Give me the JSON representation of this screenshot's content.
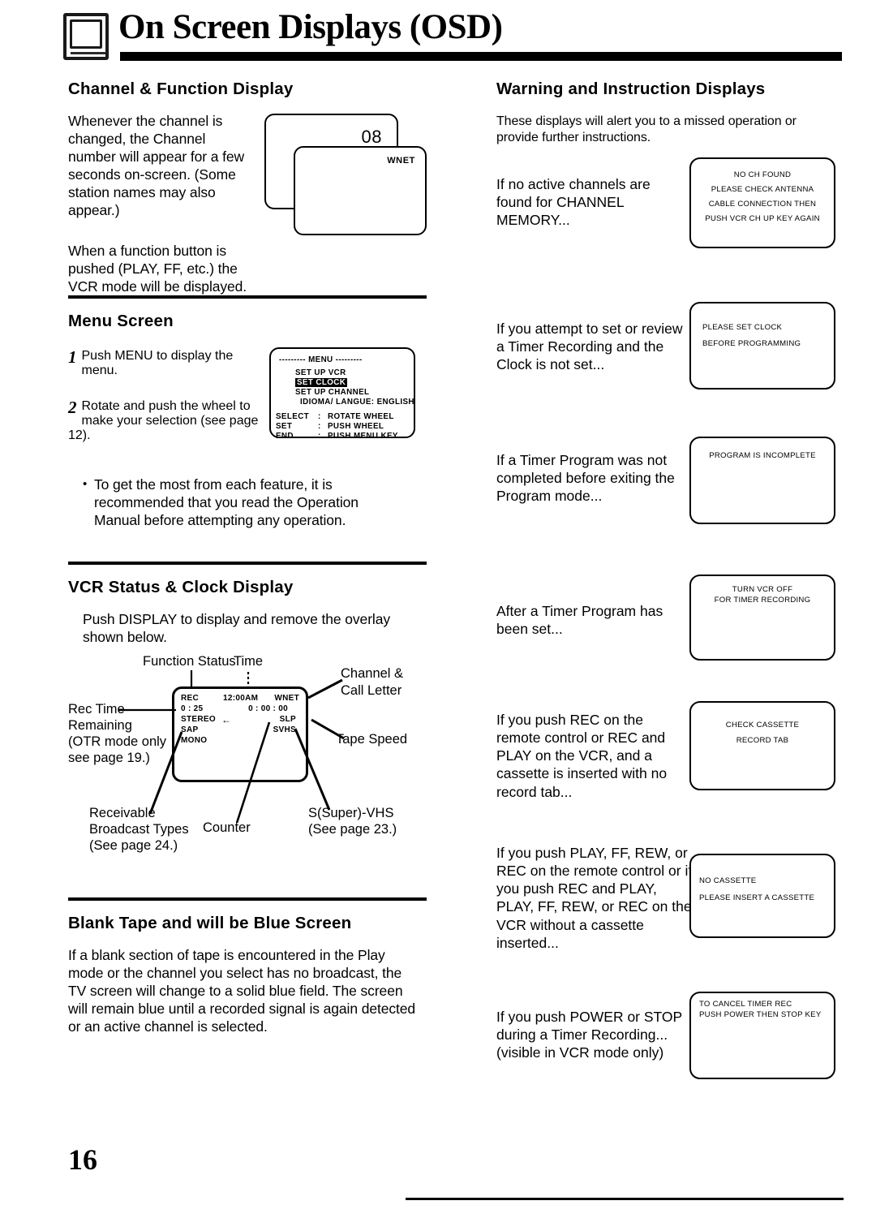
{
  "header": {
    "title": "On Screen Displays (OSD)",
    "icon": "tv-screen-icon"
  },
  "page_number": "16",
  "left_column": {
    "channel_function": {
      "heading": "Channel & Function Display",
      "paragraph1": "Whenever the channel is changed, the Channel number will appear for a few seconds on-screen. (Some station names may also appear.)",
      "paragraph2": "When a function button is pushed (PLAY, FF, etc.) the VCR mode will be displayed.",
      "screen_back_value": "08",
      "screen_front_value": "WNET"
    },
    "menu_screen": {
      "heading": "Menu Screen",
      "step1_number": "1",
      "step1_text": "Push MENU to display the menu.",
      "step2_number": "2",
      "step2_text": "Rotate and push the wheel to make your selection (see page 12).",
      "bullet": "To get the most from each feature, it is recommended that you read the Operation Manual before attempting any operation.",
      "osd": {
        "title": "--------- MENU ---------",
        "items": [
          "SET UP VCR",
          "SET CLOCK",
          "SET UP CHANNEL",
          "IDIOMA/ LANGUE: ENGLISH"
        ],
        "highlighted_item": "SET CLOCK",
        "legend": [
          {
            "key": "SELECT",
            "sep": ":",
            "value": "ROTATE  WHEEL"
          },
          {
            "key": "SET",
            "sep": ":",
            "value": "PUSH  WHEEL"
          },
          {
            "key": "END",
            "sep": ":",
            "value": "PUSH  MENU  KEY"
          }
        ]
      }
    },
    "vcr_status": {
      "heading": "VCR Status & Clock Display",
      "paragraph": "Push DISPLAY to display and remove the overlay shown below.",
      "osd": {
        "rec": "REC",
        "rec_time": "0 : 25",
        "stereo": "STEREO",
        "stereo_arrow": "←",
        "sap": "SAP",
        "mono": "MONO",
        "time": "12:00AM",
        "channel": "WNET",
        "counter": "0 : 00 : 00",
        "speed": "SLP",
        "svhs": "SVHS"
      },
      "callouts": {
        "function_status": "Function Status",
        "time": "Time",
        "channel_call_letter_1": "Channel &",
        "channel_call_letter_2": "Call Letter",
        "rec_time_1": "Rec Time",
        "rec_time_2": "Remaining",
        "rec_time_3": "(OTR mode only",
        "rec_time_4": "see page 19.)",
        "tape_speed": "Tape Speed",
        "receivable_1": "Receivable",
        "receivable_2": "Broadcast Types",
        "receivable_3": "(See page 24.)",
        "counter": "Counter",
        "svhs_1": "S(Super)-VHS",
        "svhs_2": "(See page 23.)"
      }
    },
    "blank_tape": {
      "heading": "Blank Tape and will be Blue Screen",
      "paragraph": "If a blank section of tape is encountered in the Play mode or the channel you select has no broadcast, the TV screen will change to a solid blue field. The screen will remain blue until a recorded signal is again detected or an active channel is selected."
    }
  },
  "right_column": {
    "heading": "Warning and Instruction Displays",
    "intro": "These displays will alert you to a missed operation or provide further instructions.",
    "warnings": [
      {
        "text": "If no active channels are found for CHANNEL MEMORY...",
        "align": "center",
        "lines": [
          "NO CH FOUND",
          "PLEASE CHECK ANTENNA",
          "CABLE CONNECTION THEN",
          "PUSH VCR CH UP KEY AGAIN"
        ]
      },
      {
        "text": "If you attempt to set or review a Timer Recording and the Clock is not set...",
        "align": "left",
        "lines": [
          "PLEASE SET CLOCK",
          "BEFORE PROGRAMMING"
        ]
      },
      {
        "text": "If a Timer Program was not completed before exiting the Program mode...",
        "align": "center",
        "lines": [
          "PROGRAM IS INCOMPLETE"
        ]
      },
      {
        "text": "After a Timer Program has been set...",
        "align": "center",
        "lines": [
          "TURN VCR OFF",
          "FOR TIMER RECORDING"
        ]
      },
      {
        "text": "If you push REC on the remote control or REC and PLAY on the VCR, and a cassette is inserted with no record tab...",
        "align": "center",
        "lines": [
          "CHECK CASSETTE",
          "RECORD TAB"
        ]
      },
      {
        "text": "If you push PLAY, FF, REW, or REC on the remote control or if you push REC and PLAY, PLAY, FF, REW, or REC on the VCR without a cassette inserted...",
        "align": "left",
        "lines": [
          "NO CASSETTE",
          "PLEASE INSERT A CASSETTE"
        ]
      },
      {
        "text": "If you push POWER or STOP during a Timer Recording... (visible in VCR mode only)",
        "align": "left",
        "lines": [
          "TO CANCEL TIMER REC",
          "PUSH POWER THEN STOP KEY"
        ]
      }
    ]
  }
}
